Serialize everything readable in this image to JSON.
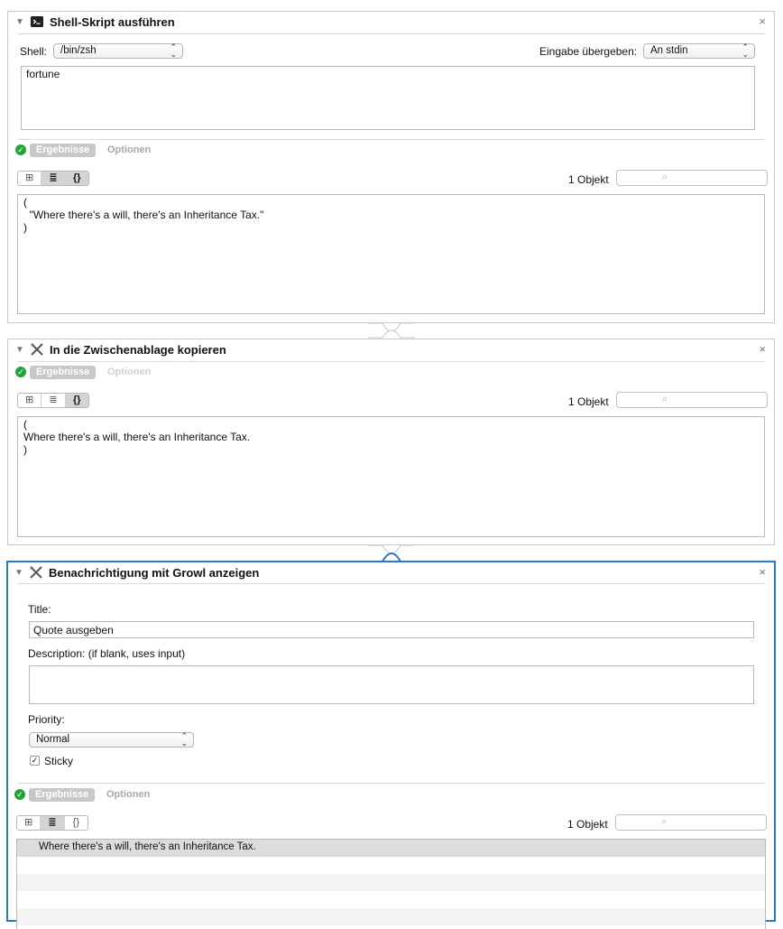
{
  "block1": {
    "title": "Shell-Skript ausführen",
    "close": "×",
    "shell_label": "Shell:",
    "shell_value": "/bin/zsh",
    "input_label": "Eingabe übergeben:",
    "input_value": "An stdin",
    "script": "fortune",
    "tab_results": "Ergebnisse",
    "tab_options": "Optionen",
    "view_icons": "⊞",
    "view_list": "≣",
    "view_code": "{}",
    "count": "1 Objekt",
    "search_icon": "⌕",
    "output_lines": [
      "(",
      "  \"Where there's a will, there's an Inheritance Tax.\"",
      ")"
    ]
  },
  "block2": {
    "title": "In die Zwischenablage kopieren",
    "close": "×",
    "tab_results": "Ergebnisse",
    "tab_options": "Optionen",
    "view_icons": "⊞",
    "view_list": "≣",
    "view_code": "{}",
    "count": "1 Objekt",
    "search_icon": "⌕",
    "output_lines": [
      "(",
      "Where there's a will, there's an Inheritance Tax.",
      ")"
    ]
  },
  "block3": {
    "title": "Benachrichtigung mit Growl anzeigen",
    "close": "×",
    "title_label": "Title:",
    "title_value": "Quote ausgeben",
    "desc_label": "Description: (if blank, uses input)",
    "desc_value": "",
    "priority_label": "Priority:",
    "priority_value": "Normal",
    "sticky_label": "Sticky",
    "sticky_checked": true,
    "check_mark": "✓",
    "tab_results": "Ergebnisse",
    "tab_options": "Optionen",
    "view_icons": "⊞",
    "view_list": "≣",
    "view_code": "{}",
    "count": "1 Objekt",
    "search_icon": "⌕",
    "result_row": "Where there's a will, there's an Inheritance Tax."
  },
  "icons": {
    "triangle": "▼",
    "popup_arrows": "⌃⌄",
    "ok": "✓"
  },
  "colors": {
    "active_border": "#2a78c8",
    "ok_green": "#26a23a",
    "selected_tab": "#c8c8c8"
  }
}
